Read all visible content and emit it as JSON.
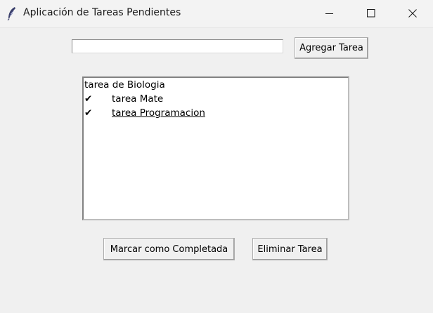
{
  "window": {
    "title": "Aplicación de Tareas Pendientes",
    "controls": [
      "minimize-icon",
      "maximize-icon",
      "close-icon"
    ]
  },
  "entry": {
    "value": "",
    "placeholder": ""
  },
  "buttons": {
    "add_label": "Agregar Tarea",
    "complete_label": "Marcar como Completada",
    "delete_label": "Eliminar Tarea"
  },
  "tasks": [
    {
      "check": "",
      "text": "tarea de Biologia",
      "active": false
    },
    {
      "check": "✔",
      "text": "tarea Mate",
      "active": false
    },
    {
      "check": "✔",
      "text": "tarea Programacion",
      "active": true
    }
  ]
}
